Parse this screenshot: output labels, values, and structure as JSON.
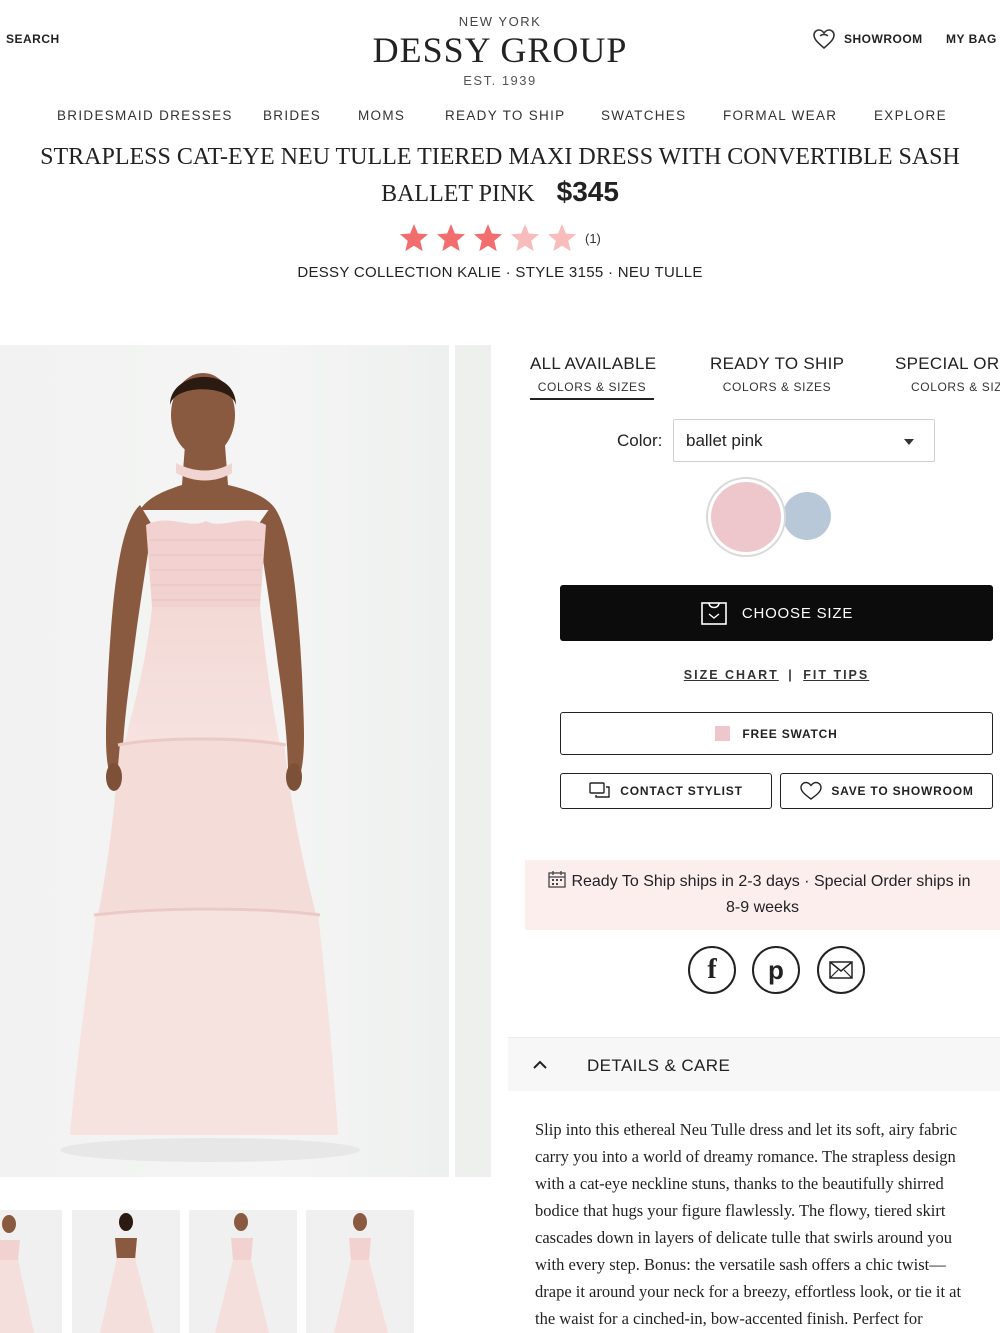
{
  "header": {
    "search_label": "SEARCH",
    "brand_city": "NEW YORK",
    "brand_name": "DESSY GROUP",
    "brand_est": "EST. 1939",
    "showroom_label": "SHOWROOM",
    "bag_label": "MY BAG"
  },
  "nav": {
    "items": [
      "BRIDESMAID DRESSES",
      "BRIDES",
      "MOMS",
      "READY TO SHIP",
      "SWATCHES",
      "FORMAL WEAR",
      "EXPLORE"
    ]
  },
  "product": {
    "title": "STRAPLESS CAT-EYE NEU TULLE TIERED MAXI DRESS WITH CONVERTIBLE SASH",
    "color_name": "BALLET PINK",
    "price": "$345",
    "rating": 3,
    "rating_max": 5,
    "review_count": "(1)",
    "meta": "DESSY COLLECTION KALIE · STYLE 3155 · NEU TULLE"
  },
  "tabs": [
    {
      "title": "ALL AVAILABLE",
      "subtitle": "COLORS & SIZES"
    },
    {
      "title": "READY TO SHIP",
      "subtitle": "COLORS & SIZES"
    },
    {
      "title": "SPECIAL ORDER",
      "subtitle": "COLORS & SIZES"
    }
  ],
  "color_select": {
    "label": "Color:",
    "value": "ballet pink"
  },
  "swatches": {
    "selected_color": "#eec7cc",
    "other_color": "#b9c8d8"
  },
  "buttons": {
    "choose_size": "CHOOSE SIZE",
    "size_chart": "SIZE CHART",
    "separator": "|",
    "fit_tips": "FIT TIPS",
    "free_swatch": "FREE SWATCH",
    "contact_stylist": "CONTACT STYLIST",
    "save_showroom": "SAVE TO SHOWROOM"
  },
  "shipping": {
    "line1": "Ready To Ship ships in 2-3 days · Special Order ships in",
    "line2": "8-9 weeks"
  },
  "details": {
    "heading": "DETAILS & CARE",
    "text": "Slip into this ethereal Neu Tulle dress and let its soft, airy fabric\ncarry you into a world of dreamy romance. The strapless design\nwith a cat-eye neckline stuns, thanks to the beautifully shirred\nbodice that hugs your figure flawlessly. The flowy, tiered skirt\ncascades down in layers of delicate tulle that swirls around you\nwith every step. Bonus: the versatile sash offers a chic twist—\ndrape it around your neck for a breezy, effortless look, or tie it at\nthe waist for a cinched-in, bow-accented finish. Perfect for"
  },
  "colors": {
    "accent_star": "#f26d6d",
    "star_faded": "#f9bcbc",
    "banner_bg": "#fdeeee",
    "dress": "#f5dcdc",
    "skin": "#8a5a40"
  }
}
